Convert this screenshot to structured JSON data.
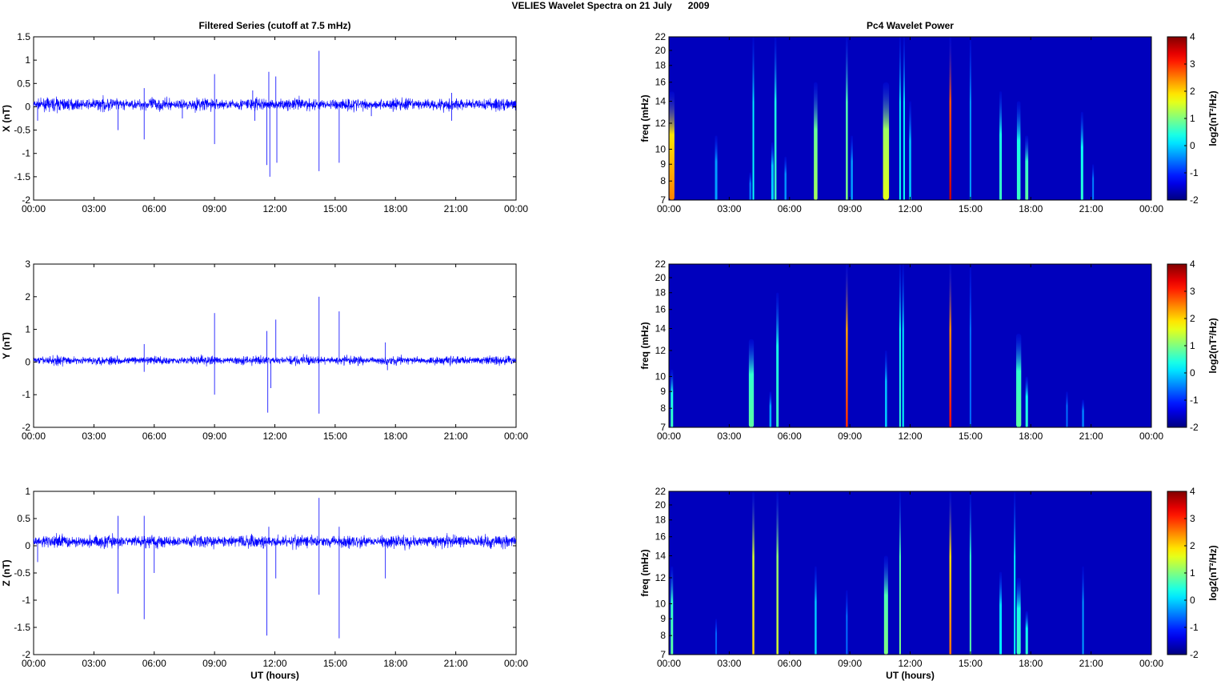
{
  "chart_data": {
    "type": "line+heatmap",
    "title": "VELIES Wavelet Spectra on 21 July      2009",
    "left_title": "Filtered Series (cutoff at 7.5 mHz)",
    "right_title": "Pc4 Wavelet Power",
    "xlabel": "UT (hours)",
    "xticks": [
      "00:00",
      "03:00",
      "06:00",
      "09:00",
      "12:00",
      "15:00",
      "18:00",
      "21:00",
      "00:00"
    ],
    "xlim": [
      0,
      24
    ],
    "series": [
      {
        "name": "X",
        "ylabel": "X (nT)",
        "ylim": [
          -2,
          1.5
        ],
        "yticks": [
          "-2",
          "-1.5",
          "-1",
          "-0.5",
          "0",
          "0.5",
          "1",
          "1.5"
        ],
        "ytick_values": [
          -2,
          -1.5,
          -1,
          -0.5,
          0,
          0.5,
          1,
          1.5
        ],
        "baseline": 0.05,
        "noise": 0.09,
        "spikes": [
          [
            0.2,
            -0.3
          ],
          [
            4.2,
            -0.5
          ],
          [
            5.5,
            -0.7
          ],
          [
            5.5,
            0.4
          ],
          [
            7.4,
            -0.25
          ],
          [
            9.0,
            0.7
          ],
          [
            9.0,
            -0.8
          ],
          [
            10.9,
            0.35
          ],
          [
            11.0,
            -0.3
          ],
          [
            11.6,
            -1.25
          ],
          [
            11.7,
            0.75
          ],
          [
            11.75,
            -1.5
          ],
          [
            12.1,
            -1.2
          ],
          [
            12.05,
            0.65
          ],
          [
            14.2,
            1.2
          ],
          [
            14.2,
            -1.38
          ],
          [
            15.2,
            -1.2
          ],
          [
            16.8,
            -0.2
          ],
          [
            20.8,
            -0.3
          ],
          [
            20.8,
            0.3
          ]
        ]
      },
      {
        "name": "Y",
        "ylabel": "Y (nT)",
        "ylim": [
          -2,
          3
        ],
        "yticks": [
          "-2",
          "-1",
          "0",
          "1",
          "2",
          "3"
        ],
        "ytick_values": [
          -2,
          -1,
          0,
          1,
          2,
          3
        ],
        "baseline": 0.05,
        "noise": 0.09,
        "spikes": [
          [
            5.5,
            0.55
          ],
          [
            5.5,
            -0.3
          ],
          [
            9.0,
            1.5
          ],
          [
            9.0,
            -1.0
          ],
          [
            11.6,
            0.95
          ],
          [
            11.65,
            -1.55
          ],
          [
            11.8,
            -0.8
          ],
          [
            12.05,
            1.3
          ],
          [
            14.2,
            2.0
          ],
          [
            14.2,
            -1.58
          ],
          [
            15.2,
            1.55
          ],
          [
            17.5,
            0.6
          ],
          [
            17.6,
            -0.25
          ]
        ]
      },
      {
        "name": "Z",
        "ylabel": "Z (nT)",
        "ylim": [
          -2,
          1
        ],
        "yticks": [
          "-2",
          "-1.5",
          "-1",
          "-0.5",
          "0",
          "0.5",
          "1"
        ],
        "ytick_values": [
          -2,
          -1.5,
          -1,
          -0.5,
          0,
          0.5,
          1
        ],
        "baseline": 0.08,
        "noise": 0.08,
        "spikes": [
          [
            0.2,
            -0.3
          ],
          [
            4.2,
            -0.88
          ],
          [
            4.2,
            0.55
          ],
          [
            5.5,
            -1.35
          ],
          [
            5.5,
            0.55
          ],
          [
            6.0,
            -0.5
          ],
          [
            11.6,
            -1.65
          ],
          [
            11.7,
            0.35
          ],
          [
            12.05,
            -0.6
          ],
          [
            14.2,
            0.88
          ],
          [
            14.2,
            -0.9
          ],
          [
            15.2,
            -1.7
          ],
          [
            15.2,
            0.35
          ],
          [
            17.5,
            -0.6
          ]
        ]
      }
    ],
    "spectra": {
      "ylabel": "freq (mHz)",
      "ylim": [
        7,
        22
      ],
      "yticks": [
        "7",
        "8",
        "9",
        "10",
        "12",
        "14",
        "16",
        "18",
        "20",
        "22"
      ],
      "ytick_values": [
        7,
        8,
        9,
        10,
        12,
        14,
        16,
        18,
        20,
        22
      ],
      "colorbar": {
        "label": "log2(nT²/Hz)",
        "range": [
          -2,
          4
        ],
        "ticks": [
          "-2",
          "-1",
          "0",
          "1",
          "2",
          "3",
          "4"
        ]
      },
      "events": [
        [
          [
            0.15,
            15,
            2.5,
            0.25
          ],
          [
            2.35,
            11,
            -0.3,
            0.12
          ],
          [
            4.2,
            22,
            0.3,
            0.08
          ],
          [
            4.05,
            8.5,
            -0.6,
            0.1
          ],
          [
            5.3,
            22,
            0.6,
            0.1
          ],
          [
            5.15,
            10.5,
            0,
            0.12
          ],
          [
            5.8,
            9.5,
            -0.4,
            0.1
          ],
          [
            7.3,
            16,
            1.2,
            0.18
          ],
          [
            8.85,
            22,
            1.0,
            0.1
          ],
          [
            9.1,
            11,
            -0.3,
            0.1
          ],
          [
            10.8,
            16,
            1.6,
            0.3
          ],
          [
            11.5,
            22,
            0.3,
            0.06
          ],
          [
            11.7,
            22,
            0.3,
            0.06
          ],
          [
            12.0,
            14,
            0,
            0.1
          ],
          [
            14.0,
            22,
            3.6,
            0.1
          ],
          [
            15.0,
            22,
            -0.3,
            0.06
          ],
          [
            16.5,
            15,
            0.6,
            0.12
          ],
          [
            17.4,
            14,
            0.6,
            0.18
          ],
          [
            17.8,
            11,
            0.8,
            0.15
          ],
          [
            20.55,
            13,
            0.5,
            0.12
          ],
          [
            21.1,
            9,
            -0.5,
            0.08
          ]
        ],
        [
          [
            0.15,
            10.5,
            0.6,
            0.12
          ],
          [
            4.1,
            13,
            0.8,
            0.25
          ],
          [
            5.05,
            9,
            -0.2,
            0.1
          ],
          [
            5.4,
            18,
            0.6,
            0.12
          ],
          [
            8.85,
            22,
            3.0,
            0.1
          ],
          [
            10.8,
            12,
            0,
            0.1
          ],
          [
            11.5,
            22,
            0.5,
            0.06
          ],
          [
            11.65,
            22,
            0.3,
            0.06
          ],
          [
            14.0,
            22,
            3.2,
            0.1
          ],
          [
            15.0,
            22,
            -0.6,
            0.05
          ],
          [
            17.4,
            13.5,
            0.8,
            0.25
          ],
          [
            17.8,
            10,
            0.5,
            0.12
          ],
          [
            19.8,
            9,
            -0.6,
            0.08
          ],
          [
            20.6,
            8.5,
            -0.5,
            0.1
          ]
        ],
        [
          [
            0.15,
            13,
            0.8,
            0.12
          ],
          [
            2.35,
            9,
            -0.7,
            0.08
          ],
          [
            4.2,
            22,
            2.0,
            0.1
          ],
          [
            5.4,
            22,
            1.5,
            0.1
          ],
          [
            7.3,
            13,
            0,
            0.1
          ],
          [
            8.85,
            11,
            -0.6,
            0.08
          ],
          [
            10.8,
            14,
            1.0,
            0.2
          ],
          [
            11.5,
            22,
            1.0,
            0.08
          ],
          [
            14.0,
            22,
            2.6,
            0.1
          ],
          [
            15.0,
            22,
            0.8,
            0.08
          ],
          [
            16.5,
            12.5,
            0.2,
            0.12
          ],
          [
            17.2,
            22,
            0.3,
            0.06
          ],
          [
            17.4,
            12,
            0.6,
            0.2
          ],
          [
            17.8,
            9.5,
            0.5,
            0.12
          ],
          [
            20.6,
            13,
            -0.3,
            0.08
          ]
        ]
      ]
    }
  }
}
